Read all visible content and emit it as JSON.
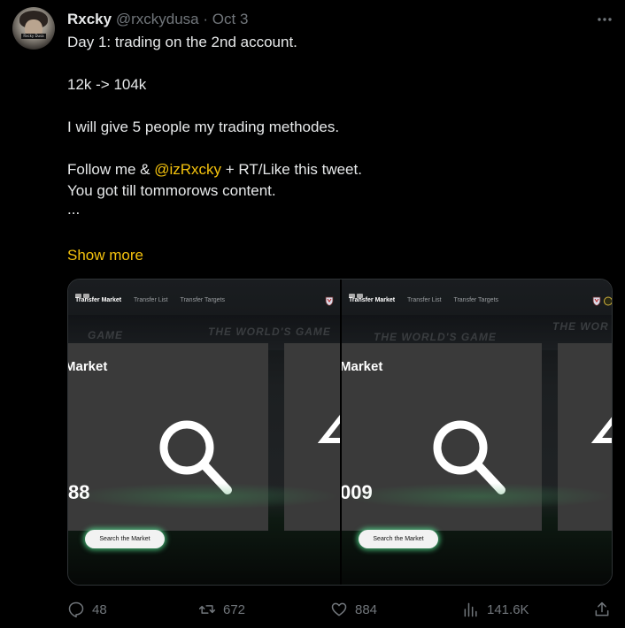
{
  "tweet": {
    "name": "Rxcky",
    "handle": "@rxckydusa",
    "separator": "·",
    "date": "Oct 3",
    "avatar_tag": "Rxcky Dusa",
    "lines": [
      "Day 1: trading on the 2nd account.",
      "",
      "12k -> 104k",
      "",
      "I will give 5 people my trading methodes.",
      "",
      "You got till tommorows content.",
      "..."
    ],
    "follow_line": {
      "before": "Follow me & ",
      "mention": "@izRxcky",
      "after": " + RT/Like this tweet."
    },
    "show_more": "Show more",
    "accent_color": "#f4c20d"
  },
  "media": {
    "left": {
      "nav": [
        "Transfer Market",
        "Transfer List",
        "Transfer Targets"
      ],
      "banner": "THE WORLD'S GAME",
      "banner_left": "GAME",
      "card_title": "Market",
      "card_number": "88",
      "button": "Search the Market",
      "card_right_glyph": "4"
    },
    "right": {
      "nav": [
        "Transfer Market",
        "Transfer List",
        "Transfer Targets"
      ],
      "banner": "THE WORLD'S GAME",
      "banner_right": "THE WOR",
      "card_title": "Market",
      "card_number": "009",
      "button": "Search the Market",
      "card_right_glyph": "4"
    }
  },
  "actions": {
    "replies": "48",
    "retweets": "672",
    "likes": "884",
    "views": "141.6K"
  },
  "icons": [
    "more-icon",
    "reply-icon",
    "retweet-icon",
    "like-icon",
    "views-icon",
    "share-icon",
    "search-icon"
  ]
}
